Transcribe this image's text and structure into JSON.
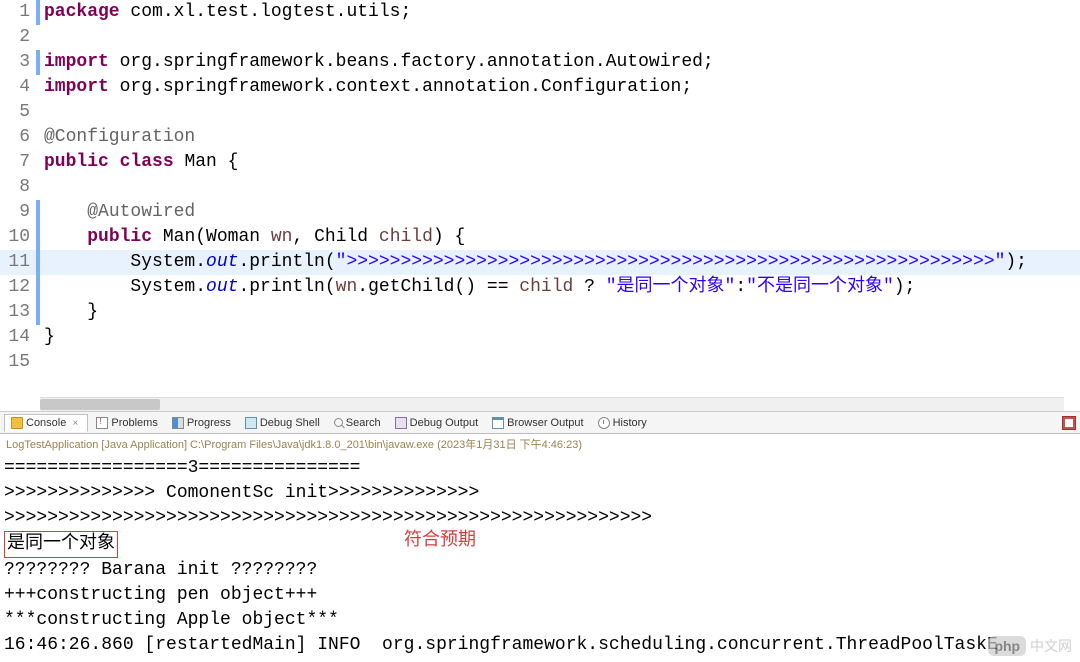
{
  "code": {
    "lines": [
      {
        "n": "1",
        "m": "blue",
        "tokens": [
          {
            "t": "package ",
            "c": "kw"
          },
          {
            "t": "com.xl.test.logtest.utils;",
            "c": "plain"
          }
        ]
      },
      {
        "n": "2",
        "m": "",
        "tokens": []
      },
      {
        "n": "3",
        "m": "blue",
        "tokens": [
          {
            "t": "import ",
            "c": "kw"
          },
          {
            "t": "org.springframework.beans.factory.annotation.Autowired;",
            "c": "plain"
          }
        ]
      },
      {
        "n": "4",
        "m": "",
        "tokens": [
          {
            "t": "import ",
            "c": "kw"
          },
          {
            "t": "org.springframework.context.annotation.Configuration;",
            "c": "plain"
          }
        ]
      },
      {
        "n": "5",
        "m": "",
        "tokens": []
      },
      {
        "n": "6",
        "m": "",
        "tokens": [
          {
            "t": "@Configuration",
            "c": "ann"
          }
        ]
      },
      {
        "n": "7",
        "m": "",
        "tokens": [
          {
            "t": "public class ",
            "c": "kw"
          },
          {
            "t": "Man {",
            "c": "plain"
          }
        ]
      },
      {
        "n": "8",
        "m": "",
        "tokens": []
      },
      {
        "n": "9",
        "m": "blue",
        "tokens": [
          {
            "t": "    ",
            "c": "plain"
          },
          {
            "t": "@Autowired",
            "c": "ann"
          }
        ]
      },
      {
        "n": "10",
        "m": "blue",
        "tokens": [
          {
            "t": "    ",
            "c": "plain"
          },
          {
            "t": "public ",
            "c": "kw"
          },
          {
            "t": "Man(Woman ",
            "c": "plain"
          },
          {
            "t": "wn",
            "c": "param"
          },
          {
            "t": ", Child ",
            "c": "plain"
          },
          {
            "t": "child",
            "c": "param"
          },
          {
            "t": ") {",
            "c": "plain"
          }
        ]
      },
      {
        "n": "11",
        "m": "blue",
        "hl": true,
        "tokens": [
          {
            "t": "        System.",
            "c": "plain"
          },
          {
            "t": "out",
            "c": "field-static"
          },
          {
            "t": ".println(",
            "c": "plain"
          },
          {
            "t": "\">>>>>>>>>>>>>>>>>>>>>>>>>>>>>>>>>>>>>>>>>>>>>>>>>>>>>>>>>>>>\"",
            "c": "str"
          },
          {
            "t": ");",
            "c": "plain"
          }
        ]
      },
      {
        "n": "12",
        "m": "blue",
        "tokens": [
          {
            "t": "        System.",
            "c": "plain"
          },
          {
            "t": "out",
            "c": "field-static"
          },
          {
            "t": ".println(",
            "c": "plain"
          },
          {
            "t": "wn",
            "c": "param"
          },
          {
            "t": ".getChild() == ",
            "c": "plain"
          },
          {
            "t": "child",
            "c": "param"
          },
          {
            "t": " ? ",
            "c": "plain"
          },
          {
            "t": "\"是同一个对象\"",
            "c": "str"
          },
          {
            "t": ":",
            "c": "plain"
          },
          {
            "t": "\"不是同一个对象\"",
            "c": "str"
          },
          {
            "t": ");",
            "c": "plain"
          }
        ]
      },
      {
        "n": "13",
        "m": "blue",
        "tokens": [
          {
            "t": "    }",
            "c": "plain"
          }
        ]
      },
      {
        "n": "14",
        "m": "",
        "tokens": [
          {
            "t": "}",
            "c": "plain"
          }
        ]
      },
      {
        "n": "15",
        "m": "",
        "tokens": []
      }
    ]
  },
  "tabs": {
    "console": "Console",
    "problems": "Problems",
    "progress": "Progress",
    "debugShell": "Debug Shell",
    "search": "Search",
    "debugOutput": "Debug Output",
    "browserOutput": "Browser Output",
    "history": "History"
  },
  "runInfo": "LogTestApplication [Java Application] C:\\Program Files\\Java\\jdk1.8.0_201\\bin\\javaw.exe (2023年1月31日 下午4:46:23)",
  "console": {
    "lines": [
      "=================3===============",
      ">>>>>>>>>>>>>> ComonentSc init>>>>>>>>>>>>>>",
      ">>>>>>>>>>>>>>>>>>>>>>>>>>>>>>>>>>>>>>>>>>>>>>>>>>>>>>>>>>>>",
      "是同一个对象",
      "???????? Barana init ????????",
      "+++constructing pen object+++",
      "***constructing Apple object***",
      "16:46:26.860 [restartedMain] INFO  org.springframework.scheduling.concurrent.ThreadPoolTaskE"
    ],
    "expectLabel": "符合预期"
  },
  "watermark": {
    "brand": "php",
    "text": "中文网"
  }
}
